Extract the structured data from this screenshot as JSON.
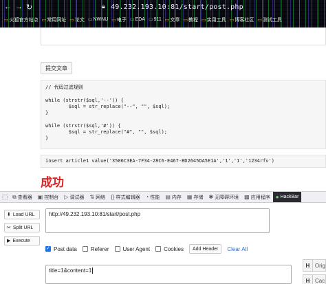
{
  "browser": {
    "url": "49.232.193.10:81/start/post.php",
    "bookmarks": [
      "火狐官方站点",
      "常用网址",
      "论文",
      "NWNU",
      "电子",
      "EDA",
      "911",
      "文章",
      "教程",
      "实用工具",
      "博客社区",
      "测试工具"
    ]
  },
  "page": {
    "submit_label": "提交文章",
    "code": "// 代码过滤规则\n\nwhile (strstr($sql,'--')) {\n        $sql = str_replace(\"--\", \"\", $sql);\n}\n\nwhile (strstr($sql,'#')) {\n        $sql = str_replace(\"#\", \"\", $sql);\n}",
    "sql": "insert article1 value('3506C3EA-7F34-28C6-E467-BD2645DA5E1A','1','1','1234rfv')",
    "success_text": "成功"
  },
  "devtools": {
    "tabs": [
      {
        "icon": "⧉",
        "label": "查看器"
      },
      {
        "icon": "▣",
        "label": "控制台"
      },
      {
        "icon": "▷",
        "label": "调试器"
      },
      {
        "icon": "⇅",
        "label": "网络"
      },
      {
        "icon": "{}",
        "label": "样式编辑器"
      },
      {
        "icon": "◔",
        "label": "性能"
      },
      {
        "icon": "▤",
        "label": "内存"
      },
      {
        "icon": "▦",
        "label": "存储"
      },
      {
        "icon": "✱",
        "label": "无障碍环境"
      },
      {
        "icon": "▩",
        "label": "应用程序"
      },
      {
        "icon": "●",
        "label": "HackBar"
      }
    ],
    "active_tab": "HackBar"
  },
  "hackbar": {
    "load_url": "Load URL",
    "split_url": "Split URL",
    "execute": "Execute",
    "url_value": "http://49.232.193.10:81/start/post.php",
    "options": [
      {
        "label": "Post data",
        "checked": true
      },
      {
        "label": "Referer",
        "checked": false
      },
      {
        "label": "User Agent",
        "checked": false
      },
      {
        "label": "Cookies",
        "checked": false
      }
    ],
    "add_header": "Add Header",
    "clear_all": "Clear All",
    "post_value": "title=1&content=1",
    "side_boxes": [
      {
        "h": "H",
        "text": "Orig"
      },
      {
        "h": "H",
        "text": "Cac"
      }
    ]
  }
}
